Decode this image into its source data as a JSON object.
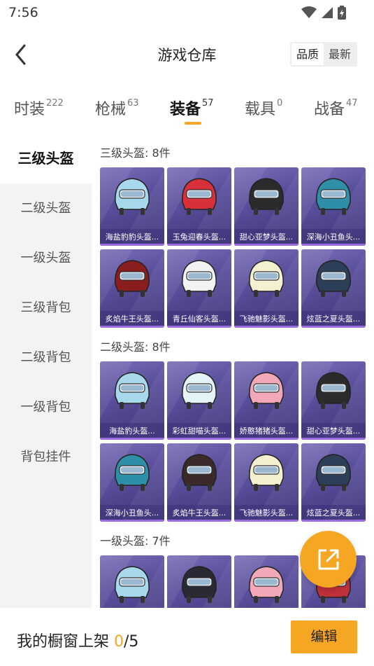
{
  "status": {
    "time": "7:56"
  },
  "nav": {
    "title": "游戏仓库",
    "sort_quality": "品质",
    "sort_latest": "最新"
  },
  "tabs": [
    {
      "label": "时装",
      "count": "222"
    },
    {
      "label": "枪械",
      "count": "63"
    },
    {
      "label": "装备",
      "count": "57"
    },
    {
      "label": "载具",
      "count": "0"
    },
    {
      "label": "战备",
      "count": "47"
    }
  ],
  "sidebar": [
    {
      "label": "三级头盔"
    },
    {
      "label": "二级头盔"
    },
    {
      "label": "一级头盔"
    },
    {
      "label": "三级背包"
    },
    {
      "label": "二级背包"
    },
    {
      "label": "一级背包"
    },
    {
      "label": "背包挂件"
    }
  ],
  "sections": [
    {
      "title": "三级头盔: 8件",
      "items": [
        {
          "name": "海盐豹豹头盔...",
          "color": "#a8d8ec"
        },
        {
          "name": "玉兔迎春头盔...",
          "color": "#d8303a"
        },
        {
          "name": "甜心亚梦头盔...",
          "color": "#2b2b2b"
        },
        {
          "name": "深海小丑鱼头...",
          "color": "#2f8fa8"
        },
        {
          "name": "炙焰牛王头盔...",
          "color": "#8a1e1e"
        },
        {
          "name": "青丘仙客头盔...",
          "color": "#f2f2f2"
        },
        {
          "name": "飞驰魅影头盔...",
          "color": "#f4f0d0"
        },
        {
          "name": "炫蓝之夏头盔...",
          "color": "#2c3e58"
        }
      ]
    },
    {
      "title": "二级头盔: 8件",
      "items": [
        {
          "name": "海盐豹头盔...",
          "color": "#a8d8ec"
        },
        {
          "name": "彩虹甜喵头盔...",
          "color": "#e4f4f6"
        },
        {
          "name": "娇憨猪猪头盔...",
          "color": "#f2a8b8"
        },
        {
          "name": "甜心亚梦头盔...",
          "color": "#2b2b2b"
        },
        {
          "name": "深海小丑鱼头...",
          "color": "#2f8fa8"
        },
        {
          "name": "炙焰牛王头盔...",
          "color": "#3a2a2a"
        },
        {
          "name": "飞驰魅影头盔...",
          "color": "#f4f0d0"
        },
        {
          "name": "炫蓝之夏头盔...",
          "color": "#2c3e58"
        }
      ]
    },
    {
      "title": "一级头盔: 7件",
      "items": [
        {
          "name": "",
          "color": "#a8d8ec"
        },
        {
          "name": "",
          "color": "#2a2a34"
        },
        {
          "name": "",
          "color": "#f2a8b8"
        },
        {
          "name": "",
          "color": "#c0303a"
        }
      ]
    }
  ],
  "bottom": {
    "label": "我的橱窗上架 ",
    "current": "0",
    "total": "/5",
    "edit": "编辑"
  },
  "colors": {
    "accent": "#f5a623"
  }
}
